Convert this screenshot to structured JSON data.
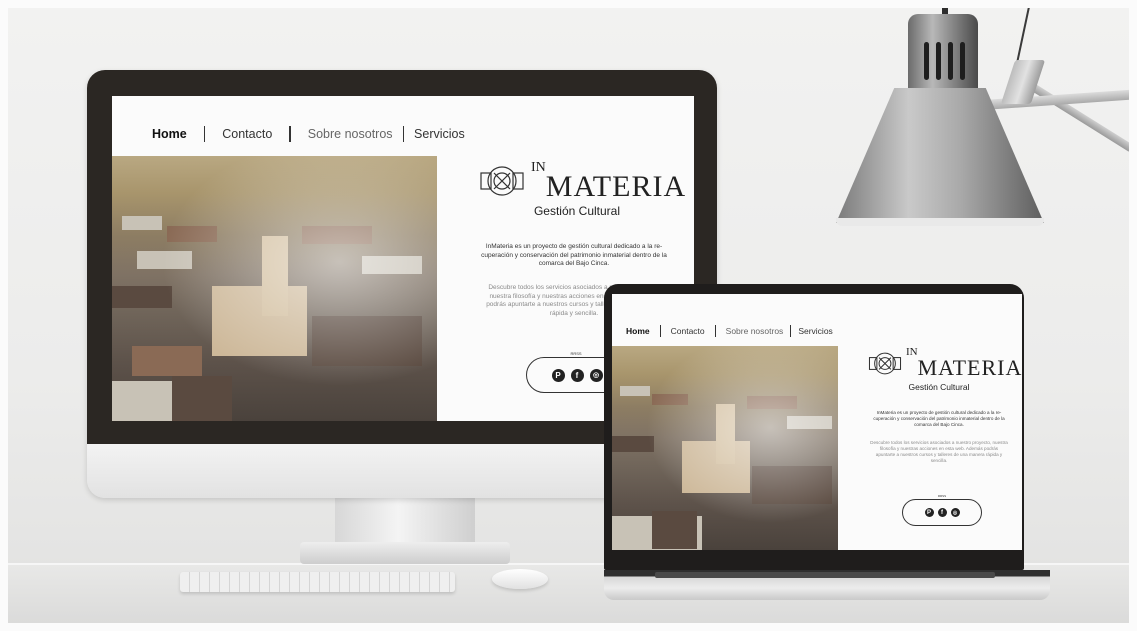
{
  "monitor_site": {
    "nav": [
      {
        "label": "Home",
        "active": true
      },
      {
        "label": "Contacto",
        "active": false
      },
      {
        "label": "Sobre nosotros",
        "active": false
      },
      {
        "label": "Servicios",
        "active": false
      }
    ],
    "logo_prefix": "IN",
    "logo_word": "MATERIA",
    "tagline": "Gestión Cultural",
    "description": "InMateria es un proyecto de gestión cultural dedicado a la re-cuperación y conservación del patrimonio inmaterial dentro de la comarca del Bajo Cinca.",
    "services_text": "Descubre todos los servicios asociados a nuestro proyecto, nuestra filosofía y nuestras acciones en esta web. Además podrás apuntarte a nuestros cursos y talleres de una manera rápida y sencilla.",
    "social_label": "RRSS",
    "social_icons": [
      "pinterest-icon",
      "facebook-icon",
      "instagram-icon"
    ]
  },
  "laptop_site": {
    "nav": [
      {
        "label": "Home",
        "active": true
      },
      {
        "label": "Contacto",
        "active": false
      },
      {
        "label": "Sobre nosotros",
        "active": false
      },
      {
        "label": "Servicios",
        "active": false
      }
    ],
    "logo_prefix": "IN",
    "logo_word": "MATERIA",
    "tagline": "Gestión Cultural",
    "description": "InMateria es un proyecto de gestión cultural dedicado a la re-cuperación y conservación del patrimonio inmaterial dentro de la comarca del Bajo Cinca.",
    "services_text": "Descubre todos los servicios asociados a nuestro proyecto, nuestra filosofía y nuestras acciones en esta web. Además podrás apuntarte a nuestros cursos y talleres de una manera rápida y sencilla.",
    "social_label": "RRSS",
    "social_icons": [
      "pinterest-icon",
      "facebook-icon",
      "instagram-icon"
    ]
  },
  "colors": {
    "bezel": "#2b2723",
    "page_bg": "#fbfbfb",
    "text": "#222222"
  }
}
